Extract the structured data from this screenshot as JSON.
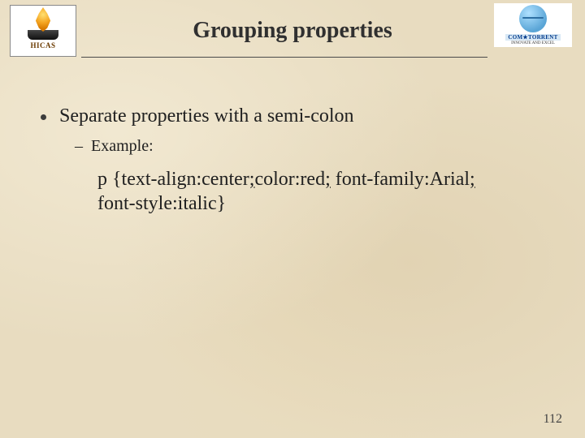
{
  "logos": {
    "left": {
      "label": "HICAS"
    },
    "right": {
      "band": "COM★TORRENT",
      "sub": "INNOVATE AND EXCEL"
    }
  },
  "title": "Grouping properties",
  "bullets": {
    "main": "Separate properties with a semi-colon",
    "sub": "Example:"
  },
  "code": {
    "p1": "p {text-align:center",
    "s1": ";",
    "p2": "color:red",
    "s2": ";",
    "p3": " font-family:Arial",
    "s3": ";",
    "p4": " font-style:italic}"
  },
  "page_number": "112"
}
